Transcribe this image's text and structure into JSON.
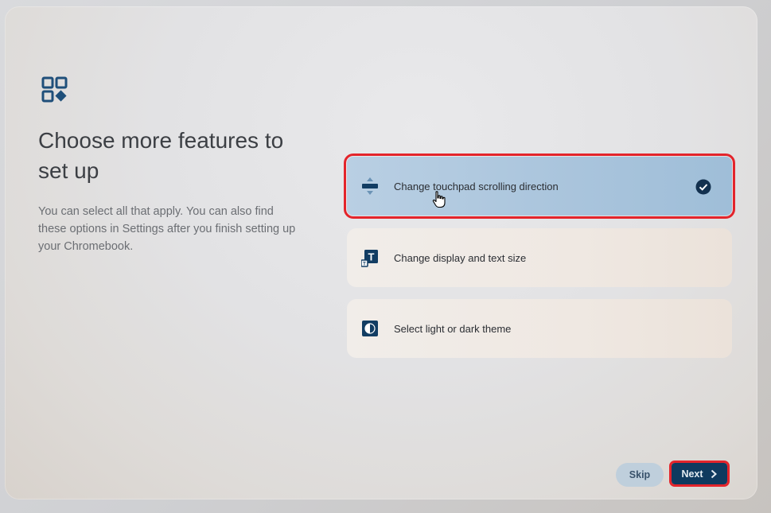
{
  "page": {
    "title": "Choose more features to set up",
    "description": "You can select all that apply. You can also find these options in Settings after you finish setting up your Chromebook."
  },
  "options": [
    {
      "label": "Change touchpad scrolling direction",
      "icon": "touchpad-scroll-icon",
      "selected": true
    },
    {
      "label": "Change display and text size",
      "icon": "text-size-icon",
      "selected": false
    },
    {
      "label": "Select light or dark theme",
      "icon": "theme-icon",
      "selected": false
    }
  ],
  "buttons": {
    "skip": "Skip",
    "next": "Next"
  },
  "colors": {
    "accent": "#0f3a5f",
    "selected_bg": "#b2cbe0",
    "highlight_box": "#e3242b"
  },
  "icons": {
    "header": "features-grid-icon",
    "check": "check-circle-icon",
    "cursor": "hand-pointer-icon",
    "next": "chevron-right-icon"
  }
}
